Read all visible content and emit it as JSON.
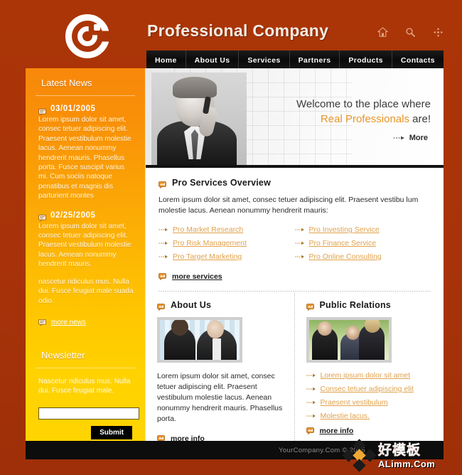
{
  "header": {
    "site_title": "Professional Company",
    "logo_name": "company-c-logo",
    "icons": [
      {
        "name": "home-icon",
        "label": "Home"
      },
      {
        "name": "search-icon",
        "label": "Search"
      },
      {
        "name": "sitemap-icon",
        "label": "Site Map"
      }
    ]
  },
  "nav": {
    "items": [
      {
        "label": "Home"
      },
      {
        "label": "About Us"
      },
      {
        "label": "Services"
      },
      {
        "label": "Partners"
      },
      {
        "label": "Products"
      },
      {
        "label": "Contacts"
      }
    ]
  },
  "sidebar": {
    "news": {
      "title": "Latest News",
      "items": [
        {
          "date": "03/01/2005",
          "body": "Lorem ipsum dolor sit amet, consec tetuer adipiscing elit. Praesent vestibulum molestie lacus. Aenean nonummy hendrerit mauris. Phasellus porta. Fusce suscipit varius mi. Cum sociis natoque penatibus et magnis dis parturient montes"
        },
        {
          "date": "02/25/2005",
          "body": "Lorem ipsum dolor sit amet, consec tetuer adipiscing elit. Praesent vestibulum molestie lacus. Aenean nonummy hendrerit mauris.",
          "body2": "nascetur ridiculus mus. Nulla dui. Fusce feugiat male suada odio."
        }
      ],
      "more_label": "more news"
    },
    "newsletter": {
      "title": "Newsletter",
      "text": "Nascetur ridiculus mus. Nulla dui. Fusce feugiat male.",
      "input_value": "",
      "input_placeholder": "",
      "submit_label": "Submit"
    }
  },
  "hero": {
    "line1": "Welcome to the place where",
    "line2_accent": "Real Professionals",
    "line2_rest": " are!",
    "more_label": "More",
    "image_name": "businessman-on-phone-photo"
  },
  "services": {
    "title": "Pro Services Overview",
    "intro": "Lorem ipsum dolor sit amet, consec tetuer adipiscing elit. Praesent vestibu lum molestie lacus. Aenean nonummy hendrerit mauris:",
    "links_left": [
      "Pro Market Research",
      "Pro Risk Management",
      "Pro Target Marketing"
    ],
    "links_right": [
      "Pro Investing Service",
      "Pro Finance Service",
      "Pro Online Consulting"
    ],
    "more_label": "more services"
  },
  "about": {
    "title": "About Us",
    "image_name": "two-businessmen-photo",
    "body": "Lorem ipsum dolor sit amet, consec tetuer adipiscing elit. Praesent vestibulum molestie lacus. Aenean nonummy hendrerit mauris. Phasellus porta.",
    "more_label": "more info"
  },
  "public_relations": {
    "title": "Public Relations",
    "image_name": "business-meeting-outdoors-photo",
    "links": [
      "Lorem ipsum dolor sit amet",
      "Consec tetuer adipiscing elit",
      "Praesent vestibulum",
      "Molestie lacus."
    ],
    "more_label": "more info"
  },
  "footer": {
    "copyright": "YourCompany.Com © 2005"
  },
  "watermark": {
    "chinese": "好模板",
    "latin": "ALimm.Com"
  },
  "colors": {
    "frame": "#a8330a",
    "sidebar_top": "#f8880b",
    "sidebar_bottom": "#ffd400",
    "nav_bg": "#0d0d0d",
    "accent_link": "#e0a24c",
    "hero_accent": "#e8962a"
  }
}
